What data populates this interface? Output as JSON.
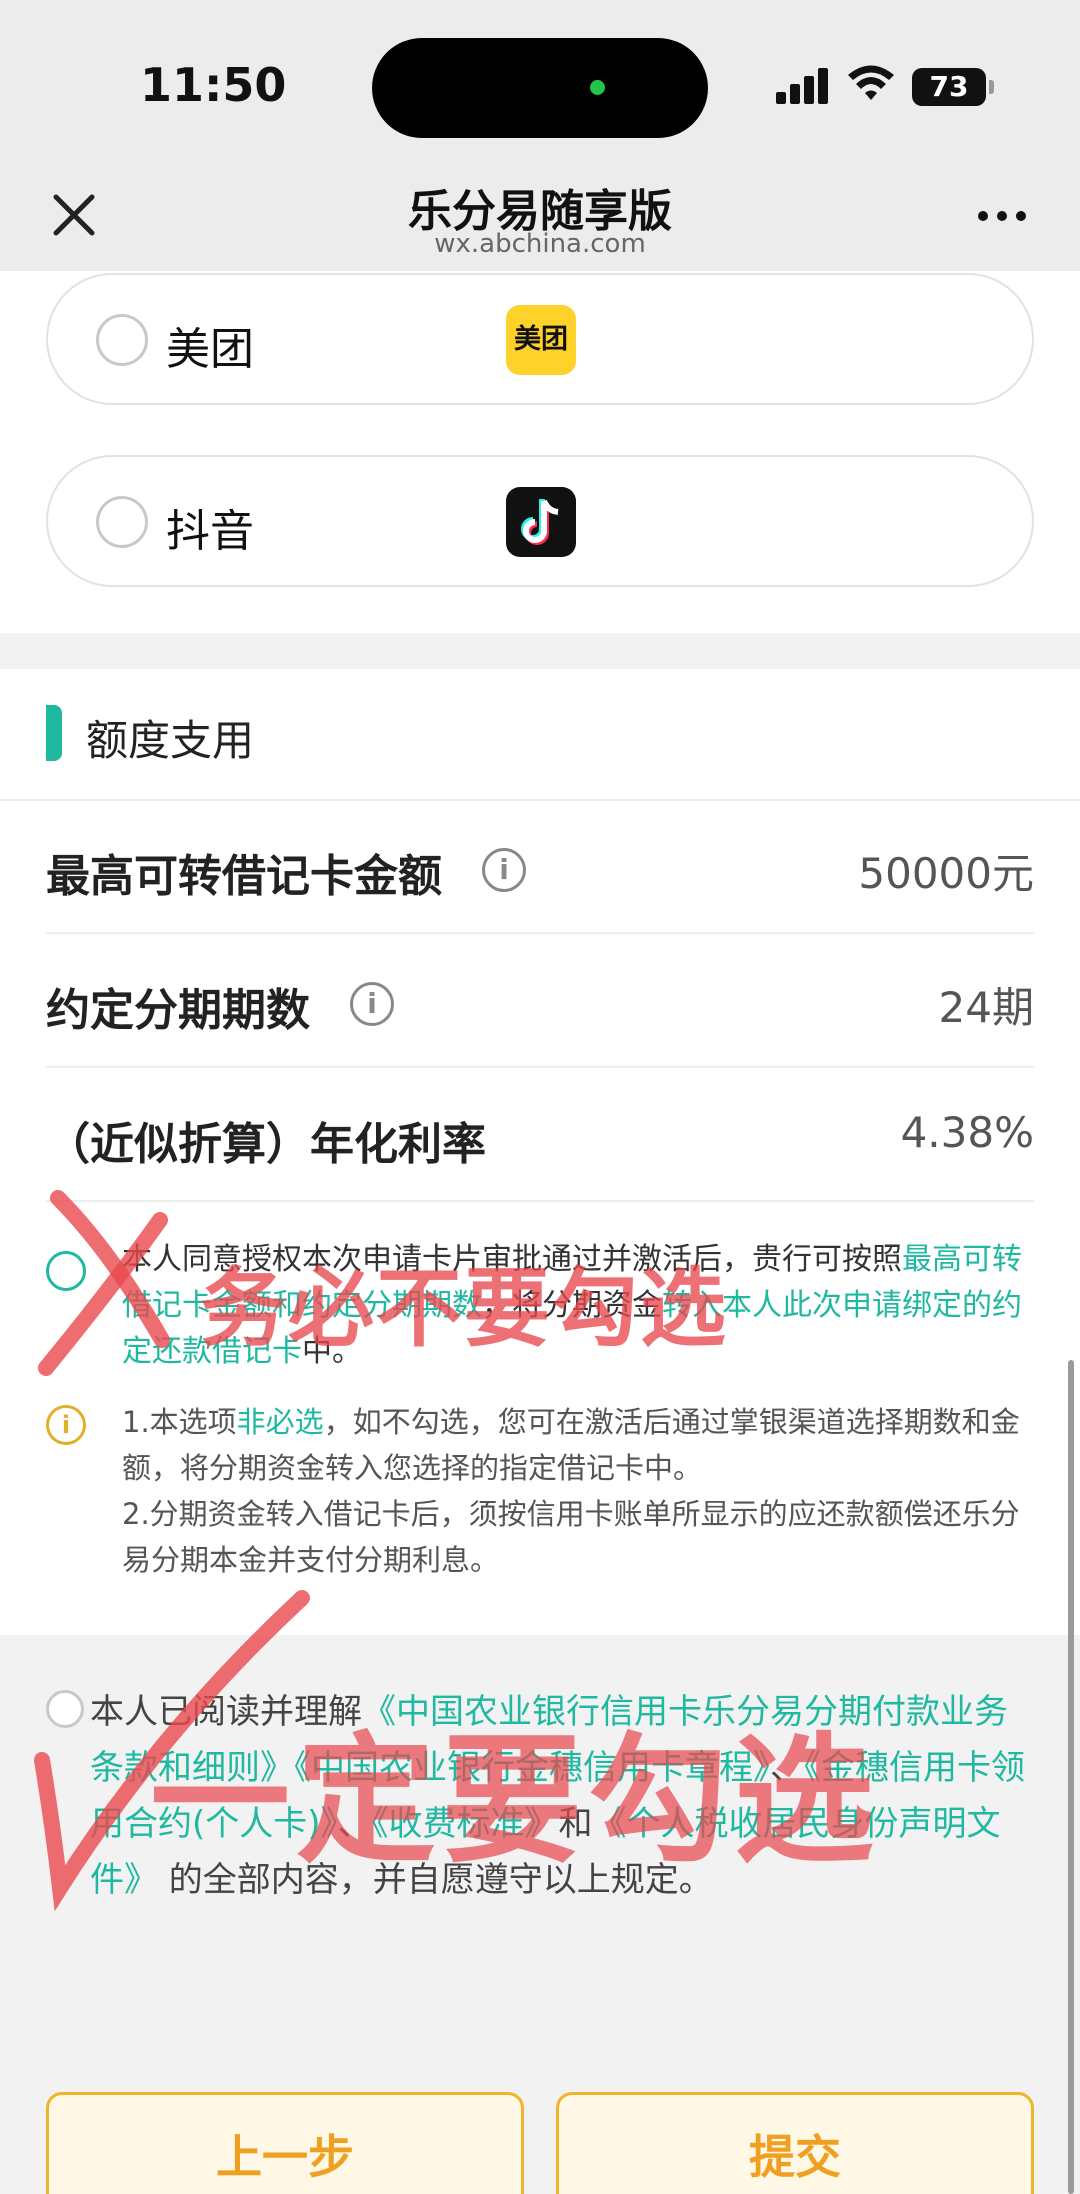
{
  "status_bar": {
    "time": "11:50",
    "battery": "73"
  },
  "nav": {
    "title": "乐分易随享版",
    "url": "wx.abchina.com"
  },
  "platforms": [
    {
      "label": "美团",
      "logo_text": "美团"
    },
    {
      "label": "抖音"
    }
  ],
  "quota": {
    "section_title": "额度支用",
    "rows": [
      {
        "label": "最高可转借记卡金额",
        "value": "50000元"
      },
      {
        "label": "约定分期期数",
        "value": "24期"
      },
      {
        "label": "（近似折算）年化利率",
        "value": "4.38%"
      }
    ],
    "agree_transfer": {
      "text_1": "本人同意授权本次申请卡片审批通过并激活后，贵行可按照",
      "link_1": "最高可转借记卡金额和约定分期期数",
      "text_2": "，将分期资金",
      "link_2": "转入本人此次申请绑定的约定还款借记卡",
      "text_3": "中。"
    },
    "notice": {
      "line1_a": "1.本选项",
      "line1_em": "非必选",
      "line1_b": "，如不勾选，您可在激活后通过掌银渠道选择期数和金额，将分期资金转入您选择的指定借记卡中。",
      "line2": "2.分期资金转入借记卡后，须按信用卡账单所显示的应还款额偿还乐分易分期本金并支付分期利息。"
    }
  },
  "agreement": {
    "prefix": "本人已阅读并理解",
    "link_1": "《中国农业银行信用卡乐分易分期付款业务条款和细则》",
    "link_2": "《中国农业银行金穗信用卡章程》",
    "sep_1": "、",
    "link_3": "《金穗信用卡领用合约(个人卡)》",
    "sep_2": "、",
    "link_4": "《收费标准》",
    "and": "和",
    "link_5": "《个人税收居民身份声明文件》",
    "suffix": " 的全部内容，并自愿遵守以上规定。"
  },
  "buttons": {
    "prev": "上一步",
    "submit": "提交"
  },
  "annotations": {
    "warning_text": "务必不要勾选",
    "must_text": "一定要勾选"
  },
  "colors": {
    "accent": "#1fb8a0",
    "button": "#f0a020",
    "annotation": "#e8484e"
  }
}
